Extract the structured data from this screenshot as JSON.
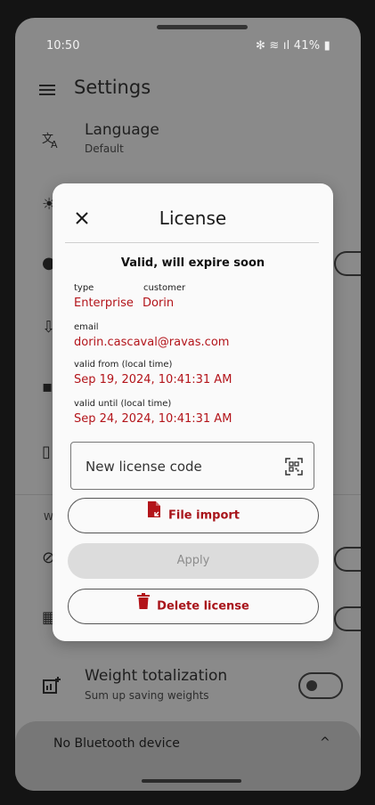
{
  "status_bar": {
    "time": "10:50",
    "indicators": "✻ ≋ ıl 41% ▮"
  },
  "app_bar": {
    "title": "Settings"
  },
  "settings": {
    "language": {
      "title": "Language",
      "subtitle": "Default"
    },
    "section_label": "W",
    "weight_totalization": {
      "title": "Weight totalization",
      "subtitle": "Sum up saving weights"
    }
  },
  "bottom_sheet": {
    "label": "No Bluetooth device",
    "chevron": "^"
  },
  "dialog": {
    "title": "License",
    "status": "Valid, will expire soon",
    "type_label": "type",
    "type_value": "Enterprise",
    "customer_label": "customer",
    "customer_value": "Dorin",
    "email_label": "email",
    "email_value": "dorin.cascaval@ravas.com",
    "valid_from_label": "valid from (local time)",
    "valid_from_value": "Sep 19, 2024, 10:41:31 AM",
    "valid_until_label": "valid until (local time)",
    "valid_until_value": "Sep 24, 2024, 10:41:31 AM",
    "code_placeholder": "New license code",
    "file_import_label": "File import",
    "apply_label": "Apply",
    "delete_label": "Delete license"
  },
  "colors": {
    "accent": "#b3141a",
    "scrim": "#8a8a8a",
    "dialog": "#fafafa"
  }
}
